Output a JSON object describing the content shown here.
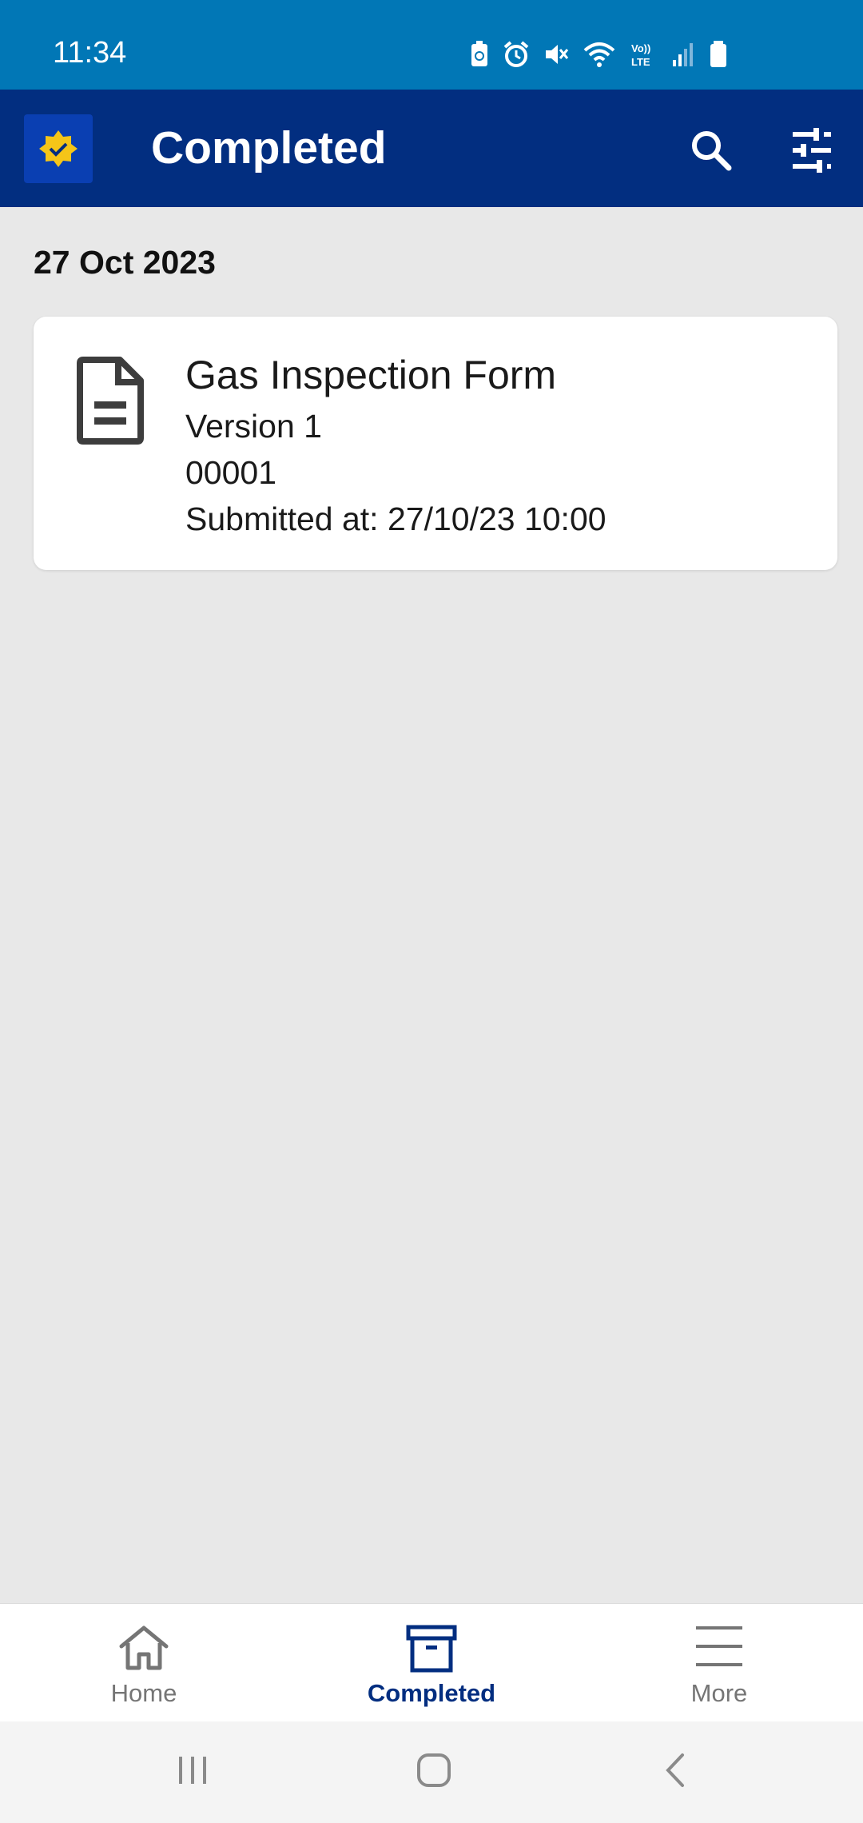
{
  "status_bar": {
    "time": "11:34"
  },
  "app_bar": {
    "title": "Completed",
    "colors": {
      "status_bar": "#0177b6",
      "app_bar": "#022e80",
      "logo_star": "#f5c518"
    }
  },
  "content": {
    "date_heading": "27 Oct 2023",
    "cards": [
      {
        "icon": "document-icon",
        "title": "Gas Inspection Form",
        "version": "Version 1",
        "number": "00001",
        "submitted": "Submitted at: 27/10/23 10:00"
      }
    ]
  },
  "bottom_nav": {
    "items": [
      {
        "label": "Home",
        "icon": "home-icon",
        "active": false
      },
      {
        "label": "Completed",
        "icon": "archive-icon",
        "active": true
      },
      {
        "label": "More",
        "icon": "menu-icon",
        "active": false
      }
    ]
  }
}
